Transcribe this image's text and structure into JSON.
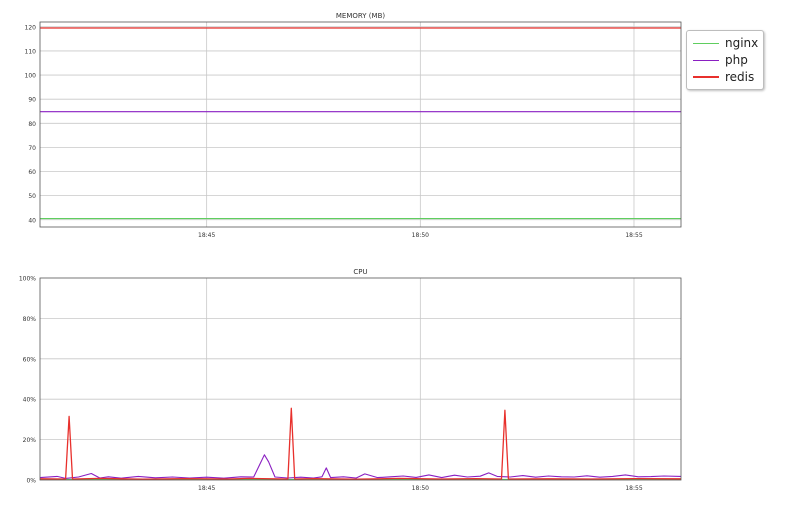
{
  "legend": [
    {
      "name": "nginx",
      "color": "#5fce5f"
    },
    {
      "name": "php",
      "color": "#8a1fc2"
    },
    {
      "name": "redis",
      "color": "#e8302c"
    }
  ],
  "chart_data": [
    {
      "type": "line",
      "title": "MEMORY (MB)",
      "xlabel": "",
      "ylabel": "",
      "x_ticks": [
        "18:45",
        "18:50",
        "18:55"
      ],
      "x_tick_minutes": [
        45,
        50,
        55
      ],
      "x_range_minutes": [
        41.1,
        56.1
      ],
      "ylim": [
        37,
        122
      ],
      "y_ticks": [
        40,
        50,
        60,
        70,
        80,
        90,
        100,
        110,
        120
      ],
      "grid": true,
      "legend_position": "outside-top-right",
      "series": [
        {
          "name": "nginx",
          "color": "#5fce5f",
          "x": [
            41.1,
            56.1
          ],
          "y": [
            40.5,
            40.5
          ]
        },
        {
          "name": "php",
          "color": "#8a1fc2",
          "x": [
            41.1,
            56.1
          ],
          "y": [
            84.8,
            84.8
          ]
        },
        {
          "name": "redis",
          "color": "#e8302c",
          "x": [
            41.1,
            56.1
          ],
          "y": [
            119.5,
            119.5
          ]
        }
      ]
    },
    {
      "type": "line",
      "title": "CPU",
      "xlabel": "",
      "ylabel": "",
      "x_ticks": [
        "18:45",
        "18:50",
        "18:55"
      ],
      "x_tick_minutes": [
        45,
        50,
        55
      ],
      "x_range_minutes": [
        41.1,
        56.1
      ],
      "ylim": [
        0,
        100
      ],
      "y_ticks": [
        0,
        20,
        40,
        60,
        80,
        100
      ],
      "y_tick_labels": [
        "0%",
        "20%",
        "40%",
        "60%",
        "80%",
        "100%"
      ],
      "grid": true,
      "series": [
        {
          "name": "nginx",
          "color": "#5fce5f",
          "x": [
            41.1,
            56.1
          ],
          "y": [
            0.3,
            0.3
          ]
        },
        {
          "name": "php",
          "color": "#8a1fc2",
          "x": [
            41.1,
            41.5,
            41.7,
            42.0,
            42.3,
            42.5,
            42.7,
            43.0,
            43.4,
            43.8,
            44.2,
            44.6,
            45.0,
            45.4,
            45.8,
            46.1,
            46.25,
            46.35,
            46.45,
            46.6,
            46.9,
            47.2,
            47.5,
            47.7,
            47.8,
            47.9,
            48.2,
            48.5,
            48.7,
            49.0,
            49.3,
            49.6,
            49.9,
            50.2,
            50.5,
            50.8,
            51.1,
            51.4,
            51.6,
            51.8,
            52.1,
            52.4,
            52.7,
            53.0,
            53.3,
            53.6,
            53.9,
            54.2,
            54.5,
            54.8,
            55.1,
            55.4,
            55.7,
            56.1
          ],
          "y": [
            1.2,
            1.8,
            0.8,
            1.5,
            3.2,
            1.0,
            1.6,
            0.9,
            1.8,
            1.1,
            1.5,
            1.0,
            1.4,
            0.9,
            1.6,
            1.5,
            8.0,
            12.5,
            9.0,
            1.5,
            1.0,
            1.4,
            1.0,
            1.6,
            6.0,
            1.2,
            1.6,
            1.0,
            3.0,
            1.2,
            1.6,
            2.0,
            1.3,
            2.5,
            1.2,
            2.4,
            1.5,
            1.9,
            3.5,
            1.8,
            1.5,
            2.2,
            1.4,
            2.0,
            1.6,
            1.5,
            2.1,
            1.4,
            1.8,
            2.5,
            1.6,
            1.7,
            2.0,
            1.8
          ]
        },
        {
          "name": "redis",
          "color": "#e8302c",
          "x": [
            41.1,
            41.7,
            41.78,
            41.86,
            42.5,
            43.5,
            44.5,
            45.5,
            46.0,
            46.9,
            46.98,
            47.06,
            47.5,
            48.5,
            49.5,
            50.5,
            51.3,
            51.9,
            51.98,
            52.06,
            53.0,
            54.0,
            55.0,
            56.1
          ],
          "y": [
            0.6,
            0.5,
            31.5,
            0.5,
            0.8,
            0.4,
            0.7,
            0.5,
            0.8,
            0.5,
            35.5,
            0.5,
            0.7,
            0.4,
            0.8,
            0.5,
            0.7,
            0.5,
            34.5,
            0.5,
            0.6,
            0.5,
            0.7,
            0.6
          ]
        }
      ]
    }
  ]
}
